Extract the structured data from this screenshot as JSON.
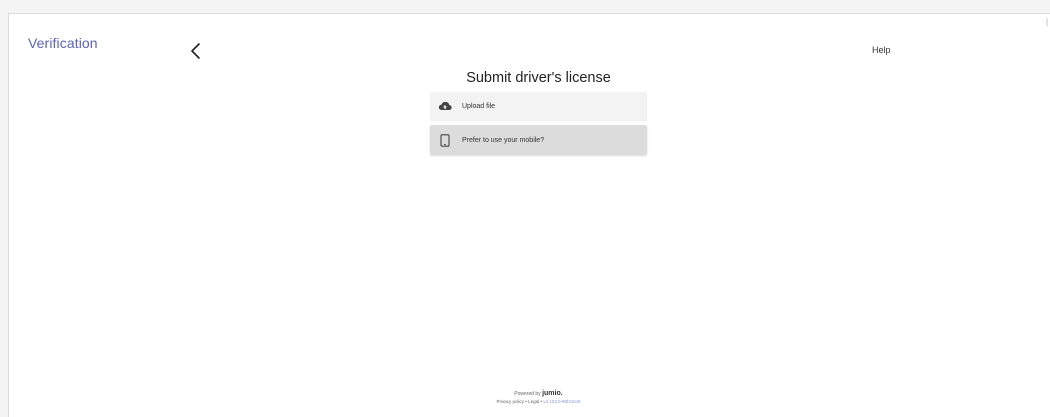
{
  "header": {
    "app_title": "Verification",
    "help_label": "Help",
    "back_icon": "chevron-left-icon"
  },
  "main": {
    "title": "Submit driver's license",
    "options": [
      {
        "label": "Upload file",
        "icon": "cloud-upload-icon"
      },
      {
        "label": "Prefer to use your mobile?",
        "icon": "mobile-phone-icon"
      }
    ]
  },
  "footer": {
    "powered_by": "Powered by",
    "brand": "jumio.",
    "privacy_label": "Privacy policy",
    "legal_label": "Legal",
    "separator": "•",
    "version": "v4.123.0-85f415c8"
  },
  "colors": {
    "accent": "#5a63b8",
    "upload_bg": "#f3f3f3",
    "mobile_bg": "#dcdcdc"
  }
}
